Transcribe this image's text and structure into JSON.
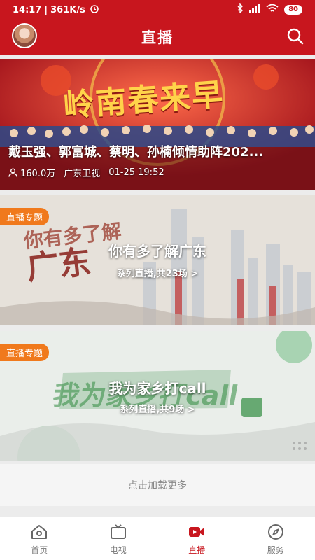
{
  "status_bar": {
    "time": "14:17",
    "speed": "361K/s",
    "battery": "80"
  },
  "header": {
    "title": "直播"
  },
  "live_item": {
    "title": "戴玉强、郭富城、蔡明、孙楠倾情助阵202...",
    "viewers": "160.0万",
    "channel": "广东卫视",
    "datetime": "01-25 19:52",
    "banner_text": "岭南春来早"
  },
  "specials": [
    {
      "badge": "直播专题",
      "title": "你有多了解广东",
      "subtitle": "系列直播,共23场 >"
    },
    {
      "badge": "直播专题",
      "title": "我为家乡打call",
      "subtitle": "系列直播,共9场 >"
    }
  ],
  "load_more": "点击加载更多",
  "tabs": [
    {
      "label": "首页",
      "icon": "home-icon"
    },
    {
      "label": "电视",
      "icon": "tv-icon"
    },
    {
      "label": "直播",
      "icon": "live-video-icon"
    },
    {
      "label": "服务",
      "icon": "compass-icon"
    }
  ],
  "colors": {
    "brand_red": "#c8161e",
    "badge_orange": "#f0791c"
  }
}
